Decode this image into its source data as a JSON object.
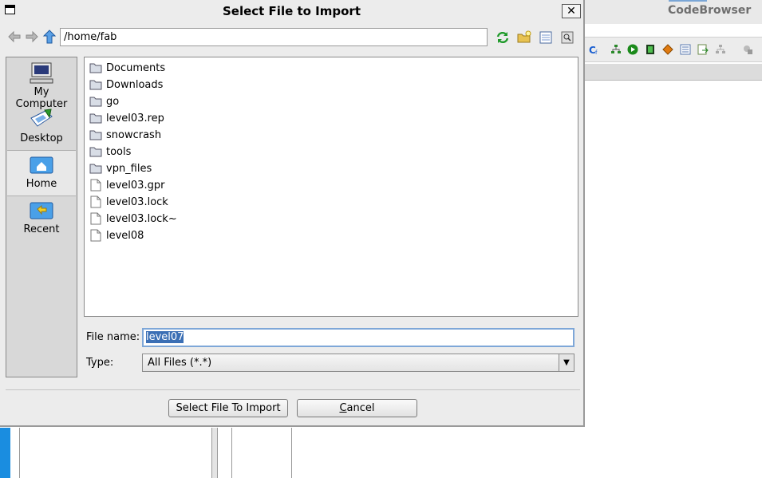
{
  "background_app": {
    "title": "CodeBrowser"
  },
  "dialog": {
    "title": "Select File to Import",
    "close_glyph": "✕",
    "path": "/home/fab",
    "places": [
      {
        "label": "My Computer",
        "icon": "computer-icon"
      },
      {
        "label": "Desktop",
        "icon": "desktop-icon"
      },
      {
        "label": "Home",
        "icon": "home-icon",
        "selected": true
      },
      {
        "label": "Recent",
        "icon": "recent-icon"
      }
    ],
    "files": [
      {
        "name": "Documents",
        "kind": "folder"
      },
      {
        "name": "Downloads",
        "kind": "folder"
      },
      {
        "name": "go",
        "kind": "folder"
      },
      {
        "name": "level03.rep",
        "kind": "folder"
      },
      {
        "name": "snowcrash",
        "kind": "folder"
      },
      {
        "name": "tools",
        "kind": "folder"
      },
      {
        "name": "vpn_files",
        "kind": "folder"
      },
      {
        "name": "level03.gpr",
        "kind": "file"
      },
      {
        "name": "level03.lock",
        "kind": "file"
      },
      {
        "name": "level03.lock~",
        "kind": "file"
      },
      {
        "name": "level08",
        "kind": "file"
      }
    ],
    "file_name_label": "File name:",
    "file_name_value": "level07",
    "type_label": "Type:",
    "type_value": "All Files (*.*)",
    "confirm_label": "Select File To Import",
    "cancel_label_first": "C",
    "cancel_label_rest": "ancel"
  },
  "colors": {
    "accent": "#3b6fb5",
    "focus": "#7ea7d8",
    "taskbar": "#1a8de0"
  }
}
